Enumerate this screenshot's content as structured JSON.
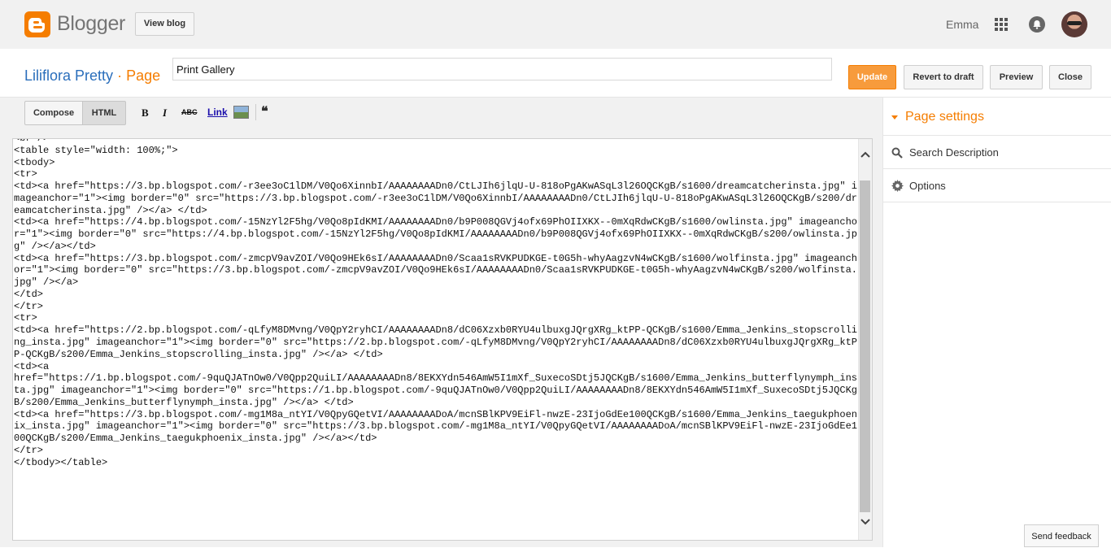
{
  "header": {
    "brand": "Blogger",
    "view_blog": "View blog",
    "user_name": "Emma"
  },
  "titlebar": {
    "blog_name": "Liliflora Pretty",
    "separator": "·",
    "kind": "Page",
    "page_title": "Print Gallery",
    "update": "Update",
    "revert": "Revert to draft",
    "preview": "Preview",
    "close": "Close"
  },
  "toolbar": {
    "compose": "Compose",
    "html": "HTML",
    "bold": "B",
    "italic": "I",
    "strike": "ABC",
    "link": "Link",
    "quote": "❝"
  },
  "sidebar": {
    "page_settings": "Page settings",
    "search_description": "Search Description",
    "options": "Options"
  },
  "editor": {
    "content": "<br />\n<table style=\"width: 100%;\">\n<tbody>\n<tr>\n<td><a href=\"https://3.bp.blogspot.com/-r3ee3oC1lDM/V0Qo6XinnbI/AAAAAAAADn0/CtLJIh6jlqU-U-818oPgAKwASqL3l26OQCKgB/s1600/dreamcatcherinsta.jpg\" imageanchor=\"1\"><img border=\"0\" src=\"https://3.bp.blogspot.com/-r3ee3oC1lDM/V0Qo6XinnbI/AAAAAAAADn0/CtLJIh6jlqU-U-818oPgAKwASqL3l26OQCKgB/s200/dreamcatcherinsta.jpg\" /></a> </td>\n<td><a href=\"https://4.bp.blogspot.com/-15NzYl2F5hg/V0Qo8pIdKMI/AAAAAAAADn0/b9P008QGVj4ofx69PhOIIXKX--0mXqRdwCKgB/s1600/owlinsta.jpg\" imageanchor=\"1\"><img border=\"0\" src=\"https://4.bp.blogspot.com/-15NzYl2F5hg/V0Qo8pIdKMI/AAAAAAAADn0/b9P008QGVj4ofx69PhOIIXKX--0mXqRdwCKgB/s200/owlinsta.jpg\" /></a></td>\n<td><a href=\"https://3.bp.blogspot.com/-zmcpV9avZOI/V0Qo9HEk6sI/AAAAAAAADn0/Scaa1sRVKPUDKGE-t0G5h-whyAagzvN4wCKgB/s1600/wolfinsta.jpg\" imageanchor=\"1\"><img border=\"0\" src=\"https://3.bp.blogspot.com/-zmcpV9avZOI/V0Qo9HEk6sI/AAAAAAAADn0/Scaa1sRVKPUDKGE-t0G5h-whyAagzvN4wCKgB/s200/wolfinsta.jpg\" /></a>\n</td>\n</tr>\n<tr>\n<td><a href=\"https://2.bp.blogspot.com/-qLfyM8DMvng/V0QpY2ryhCI/AAAAAAAADn8/dC06Xzxb0RYU4ulbuxgJQrgXRg_ktPP-QCKgB/s1600/Emma_Jenkins_stopscrolling_insta.jpg\" imageanchor=\"1\"><img border=\"0\" src=\"https://2.bp.blogspot.com/-qLfyM8DMvng/V0QpY2ryhCI/AAAAAAAADn8/dC06Xzxb0RYU4ulbuxgJQrgXRg_ktPP-QCKgB/s200/Emma_Jenkins_stopscrolling_insta.jpg\" /></a> </td>\n<td><a\nhref=\"https://1.bp.blogspot.com/-9quQJATnOw0/V0Qpp2QuiLI/AAAAAAAADn8/8EKXYdn546AmW5I1mXf_SuxecoSDtj5JQCKgB/s1600/Emma_Jenkins_butterflynymph_insta.jpg\" imageanchor=\"1\"><img border=\"0\" src=\"https://1.bp.blogspot.com/-9quQJATnOw0/V0Qpp2QuiLI/AAAAAAAADn8/8EKXYdn546AmW5I1mXf_SuxecoSDtj5JQCKgB/s200/Emma_Jenkins_butterflynymph_insta.jpg\" /></a> </td>\n<td><a href=\"https://3.bp.blogspot.com/-mg1M8a_ntYI/V0QpyGQetVI/AAAAAAAADoA/mcnSBlKPV9EiFl-nwzE-23IjoGdEe100QCKgB/s1600/Emma_Jenkins_taegukphoenix_insta.jpg\" imageanchor=\"1\"><img border=\"0\" src=\"https://3.bp.blogspot.com/-mg1M8a_ntYI/V0QpyGQetVI/AAAAAAAADoA/mcnSBlKPV9EiFl-nwzE-23IjoGdEe100QCKgB/s200/Emma_Jenkins_taegukphoenix_insta.jpg\" /></a></td>\n</tr>\n</tbody></table>"
  },
  "footer": {
    "send_feedback": "Send feedback"
  },
  "colors": {
    "accent": "#f57d00",
    "link": "#2a6ebb"
  }
}
